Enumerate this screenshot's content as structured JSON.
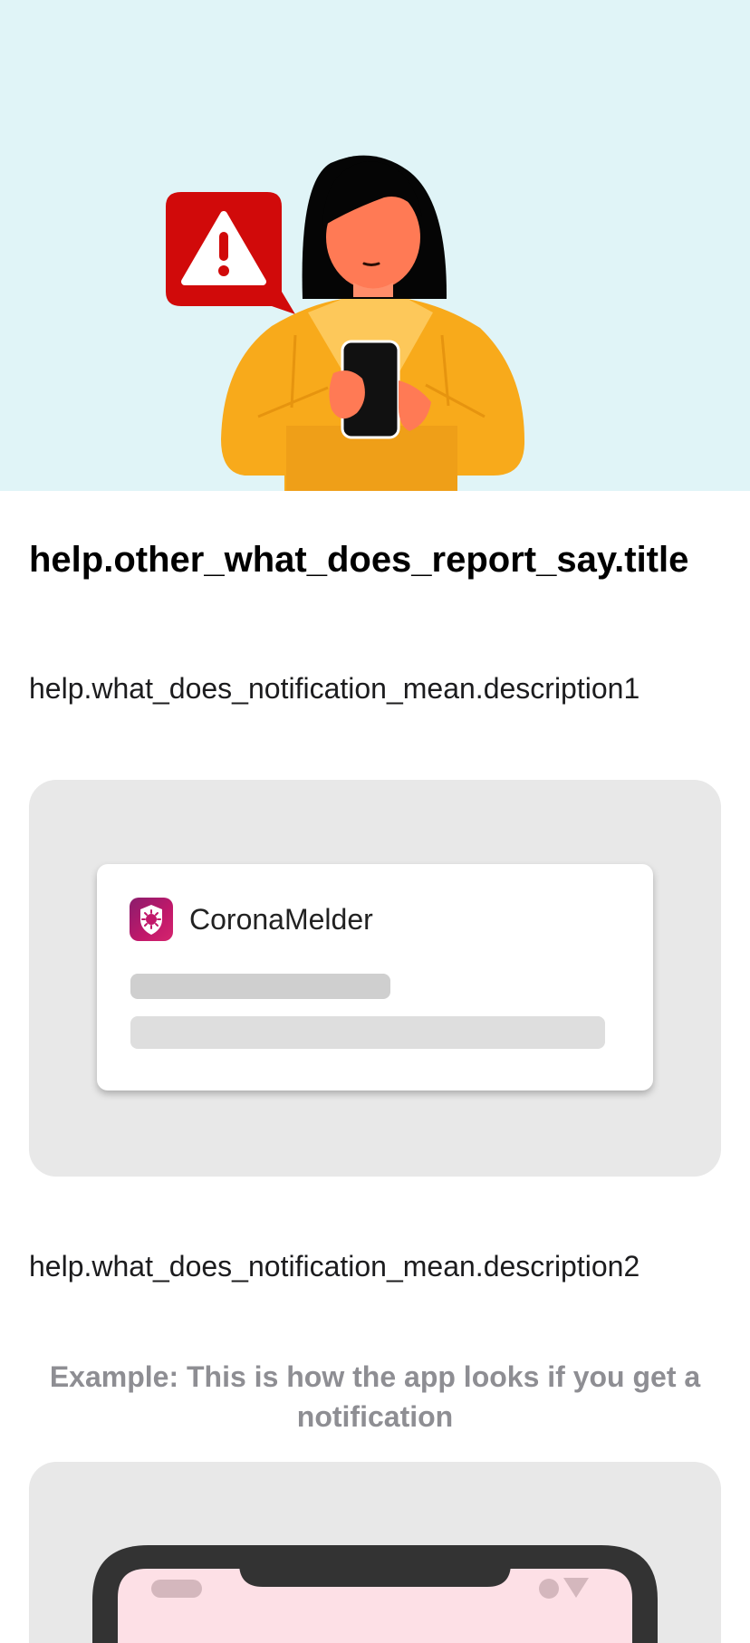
{
  "hero": {
    "illustration": "woman-holding-phone-with-warning-alert",
    "colors": {
      "background": "#e0f4f7",
      "alert": "#d10a0a",
      "sweater": "#f8aa1b"
    }
  },
  "content": {
    "title": "help.other_what_does_report_say.title",
    "description1": "help.what_does_notification_mean.description1",
    "description2": "help.what_does_notification_mean.description2",
    "example_caption": "Example: This is how the app looks if you get a notification"
  },
  "notification_preview": {
    "app_icon": "coronamelder-shield-icon",
    "app_name": "CoronaMelder"
  },
  "phone_preview": {
    "icon": "phone-mockup-icon",
    "colors": {
      "frame": "#333333",
      "screen": "#fde0e6"
    }
  }
}
